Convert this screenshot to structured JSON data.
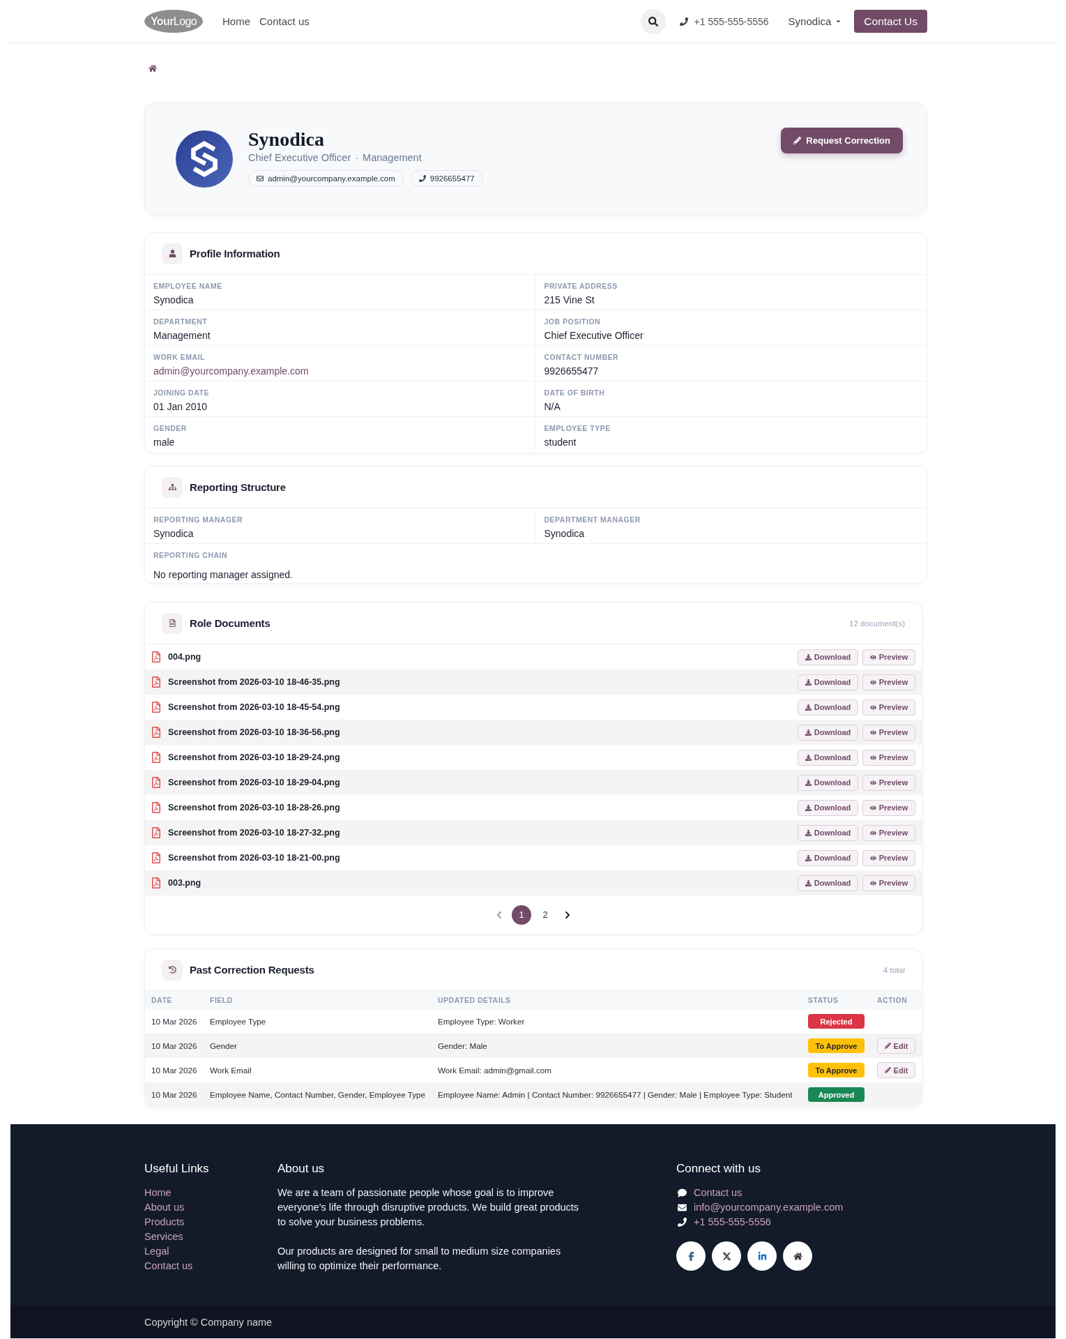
{
  "navbar": {
    "logo": "**Your**Logo",
    "links": [
      {
        "label": "Home"
      },
      {
        "label": "Contact us"
      }
    ],
    "phone": "+1 555-555-5556",
    "user_menu": "Synodica",
    "cta": "Contact Us"
  },
  "profile": {
    "name": "Synodica",
    "job_title": "Chief Executive Officer",
    "separator": "·",
    "department": "Management",
    "email": "admin@yourcompany.example.com",
    "phone": "9926655477",
    "action": "Request Correction"
  },
  "profile_information": {
    "title": "Profile Information",
    "fields": [
      {
        "label": "EMPLOYEE NAME",
        "value": "Synodica",
        "kind": "text"
      },
      {
        "label": "PRIVATE ADDRESS",
        "value": "215 Vine St",
        "kind": "text"
      },
      {
        "label": "DEPARTMENT",
        "value": "Management",
        "kind": "text"
      },
      {
        "label": "JOB POSITION",
        "value": "Chief Executive Officer",
        "kind": "text"
      },
      {
        "label": "WORK EMAIL",
        "value": "admin@yourcompany.example.com",
        "kind": "link"
      },
      {
        "label": "CONTACT NUMBER",
        "value": "9926655477",
        "kind": "text"
      },
      {
        "label": "JOINING DATE",
        "value": "01 Jan 2010",
        "kind": "text"
      },
      {
        "label": "DATE OF BIRTH",
        "value": "N/A",
        "kind": "text"
      },
      {
        "label": "GENDER",
        "value": "male",
        "kind": "text"
      },
      {
        "label": "EMPLOYEE TYPE",
        "value": "student",
        "kind": "text"
      }
    ]
  },
  "reporting_structure": {
    "title": "Reporting Structure",
    "fields": [
      {
        "label": "REPORTING MANAGER",
        "value": "Synodica"
      },
      {
        "label": "DEPARTMENT MANAGER",
        "value": "Synodica"
      }
    ],
    "chain": {
      "label": "REPORTING CHAIN",
      "value": "No reporting manager assigned."
    }
  },
  "role_documents": {
    "title": "Role Documents",
    "count": "12 document(s)",
    "documents": [
      {
        "name": "004.png",
        "download": "Download",
        "preview": "Preview"
      },
      {
        "name": "Screenshot from 2026-03-10 18-46-35.png",
        "download": "Download",
        "preview": "Preview"
      },
      {
        "name": "Screenshot from 2026-03-10 18-45-54.png",
        "download": "Download",
        "preview": "Preview"
      },
      {
        "name": "Screenshot from 2026-03-10 18-36-56.png",
        "download": "Download",
        "preview": "Preview"
      },
      {
        "name": "Screenshot from 2026-03-10 18-29-24.png",
        "download": "Download",
        "preview": "Preview"
      },
      {
        "name": "Screenshot from 2026-03-10 18-29-04.png",
        "download": "Download",
        "preview": "Preview"
      },
      {
        "name": "Screenshot from 2026-03-10 18-28-26.png",
        "download": "Download",
        "preview": "Preview"
      },
      {
        "name": "Screenshot from 2026-03-10 18-27-32.png",
        "download": "Download",
        "preview": "Preview"
      },
      {
        "name": "Screenshot from 2026-03-10 18-21-00.png",
        "download": "Download",
        "preview": "Preview"
      },
      {
        "name": "003.png",
        "download": "Download",
        "preview": "Preview"
      }
    ],
    "pagination": {
      "previous": {
        "disabled": true
      },
      "pages": [
        {
          "label": "1",
          "selected": true
        },
        {
          "label": "2",
          "selected": false
        }
      ],
      "next": {
        "disabled": false
      }
    }
  },
  "past_correction_requests": {
    "title": "Past Correction Requests",
    "count": "4 total",
    "columns": [
      "DATE",
      "FIELD",
      "UPDATED DETAILS",
      "STATUS",
      "ACTION"
    ],
    "rows": [
      {
        "date": "10 Mar 2026",
        "field": "Employee Type",
        "details": "Employee Type: Worker",
        "status": {
          "label": "Rejected",
          "kind": "rejected"
        }
      },
      {
        "date": "10 Mar 2026",
        "field": "Gender",
        "details": "Gender: Male",
        "status": {
          "label": "To Approve",
          "kind": "pending"
        },
        "action": "Edit"
      },
      {
        "date": "10 Mar 2026",
        "field": "Work Email",
        "details": "Work Email: admin@gmail.com",
        "status": {
          "label": "To Approve",
          "kind": "pending"
        },
        "action": "Edit"
      },
      {
        "date": "10 Mar 2026",
        "field": "Employee Name, Contact Number, Gender, Employee Type",
        "details": "Employee Name: Admin | Contact Number: 9926655477 | Gender: Male | Employee Type: Student",
        "status": {
          "label": "Approved",
          "kind": "approved"
        }
      }
    ]
  },
  "footer": {
    "useful_links": {
      "title": "Useful Links",
      "links": [
        "Home",
        "About us",
        "Products",
        "Services",
        "Legal",
        "Contact us"
      ]
    },
    "about": {
      "title": "About us",
      "paragraphs": [
        "We are a team of passionate people whose goal is to improve everyone's life through disruptive products. We build great products to solve your business problems.",
        "Our products are designed for small to medium size companies willing to optimize their performance."
      ]
    },
    "connect": {
      "title": "Connect with us",
      "items": [
        {
          "kind": "chat",
          "label": "Contact us"
        },
        {
          "kind": "email",
          "label": "info@yourcompany.example.com"
        },
        {
          "kind": "phone",
          "label": "+1 555-555-5556"
        }
      ]
    },
    "copyright": "Copyright © Company name"
  }
}
